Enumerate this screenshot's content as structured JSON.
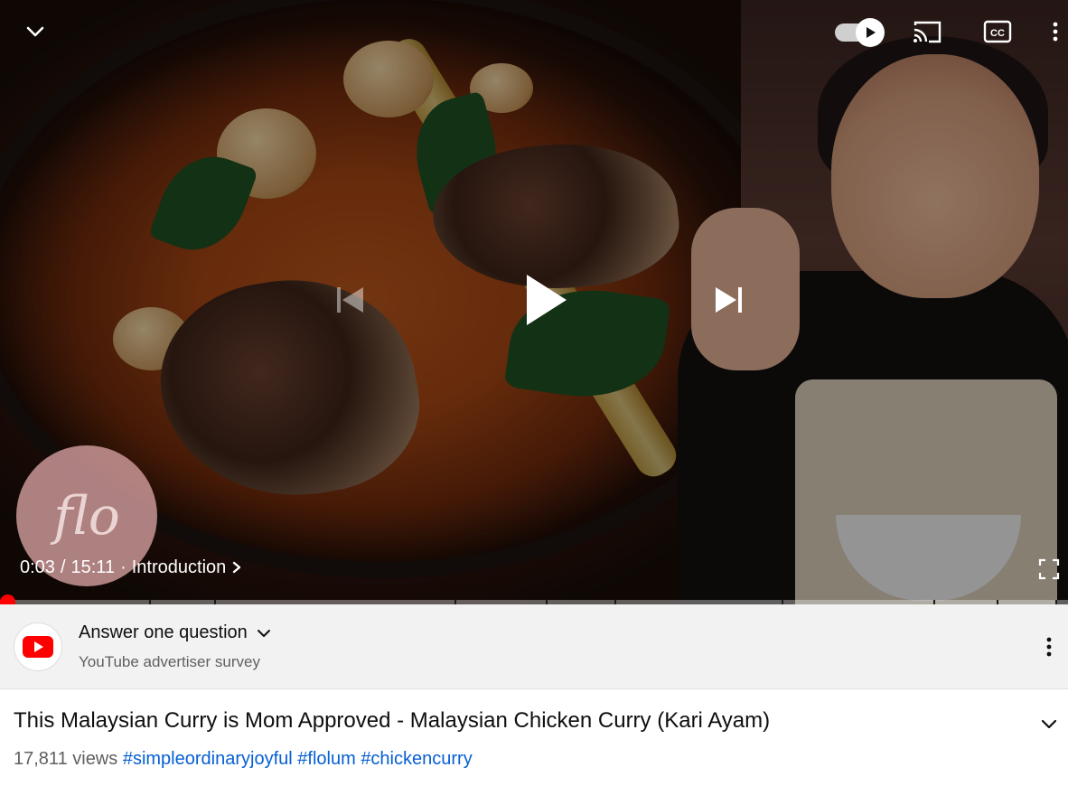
{
  "player": {
    "current_time": "0:03",
    "duration": "15:11",
    "separator": "/",
    "chapter_dot": "·",
    "chapter": "Introduction",
    "progress_fraction": 0.0033,
    "watermark_text": "flo",
    "icons": [
      "chevron-down-icon",
      "autoplay-toggle-icon",
      "cast-icon",
      "closed-captions-icon",
      "more-vert-icon",
      "previous-icon",
      "play-icon",
      "next-icon",
      "chevron-right-icon",
      "fullscreen-icon"
    ],
    "cc_label": "CC",
    "progress_color": "#ff0000"
  },
  "ad": {
    "title": "Answer one question",
    "subtitle": "YouTube advertiser survey",
    "logo_color": "#ff0000"
  },
  "video": {
    "title": "This Malaysian Curry is Mom Approved - Malaysian Chicken Curry (Kari Ayam)",
    "views": "17,811 views",
    "hashtags": [
      "#simpleordinaryjoyful",
      "#flolum",
      "#chickencurry"
    ],
    "hashtag_color": "#065fd4"
  }
}
